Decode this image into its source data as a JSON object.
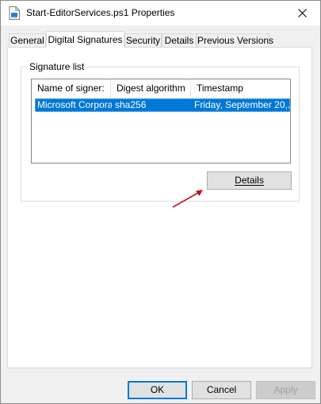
{
  "window": {
    "title": "Start-EditorServices.ps1 Properties"
  },
  "tabs": [
    {
      "label": "General",
      "active": false
    },
    {
      "label": "Digital Signatures",
      "active": true
    },
    {
      "label": "Security",
      "active": false
    },
    {
      "label": "Details",
      "active": false
    },
    {
      "label": "Previous Versions",
      "active": false
    }
  ],
  "signature_list": {
    "group_label": "Signature list",
    "columns": [
      "Name of signer:",
      "Digest algorithm",
      "Timestamp"
    ],
    "rows": [
      {
        "signer": "Microsoft Corpora...",
        "digest": "sha256",
        "timestamp": "Friday, September 20,...",
        "selected": true
      }
    ],
    "details_button_label": "Details"
  },
  "footer": {
    "ok_label": "OK",
    "cancel_label": "Cancel",
    "apply_label": "Apply"
  },
  "colors": {
    "selection": "#0078d7",
    "annotation_arrow": "#c0121b"
  },
  "icons": {
    "title": "script-file-icon",
    "close": "close-icon",
    "annotation": "red-arrow-icon"
  }
}
